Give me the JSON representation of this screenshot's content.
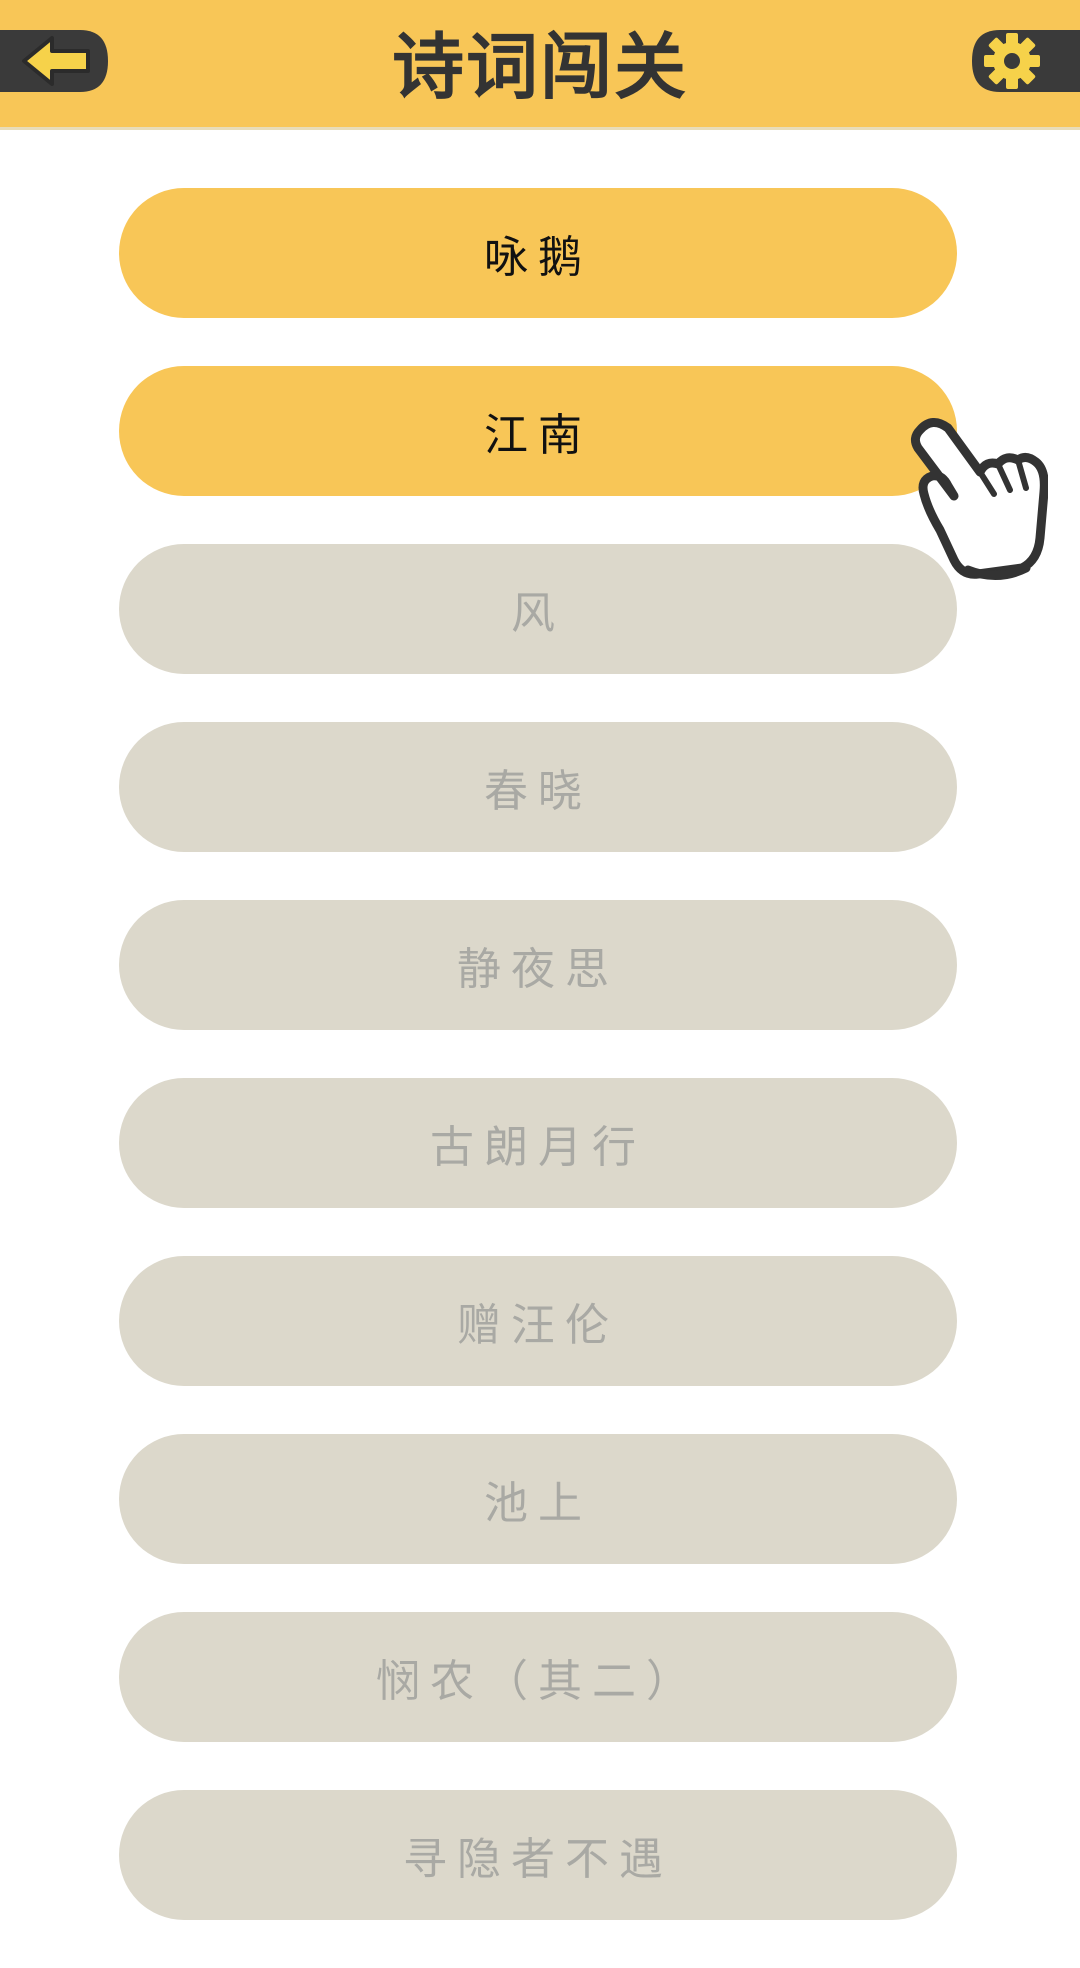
{
  "header": {
    "title": "诗词闯关",
    "back_icon": "back-arrow-icon",
    "settings_icon": "gear-icon"
  },
  "colors": {
    "accent": "#f8c657",
    "locked": "#dcd8cb",
    "locked_text": "#a9a9a4",
    "title_text": "#333333"
  },
  "levels": [
    {
      "label": "咏鹅",
      "state": "unlocked"
    },
    {
      "label": "江南",
      "state": "unlocked"
    },
    {
      "label": "风",
      "state": "locked"
    },
    {
      "label": "春晓",
      "state": "locked"
    },
    {
      "label": "静夜思",
      "state": "locked"
    },
    {
      "label": "古朗月行",
      "state": "locked"
    },
    {
      "label": "赠汪伦",
      "state": "locked"
    },
    {
      "label": "池上",
      "state": "locked"
    },
    {
      "label": "悯农（其二）",
      "state": "locked"
    },
    {
      "label": "寻隐者不遇",
      "state": "locked"
    }
  ],
  "pointer_icon": "pointing-hand-icon"
}
